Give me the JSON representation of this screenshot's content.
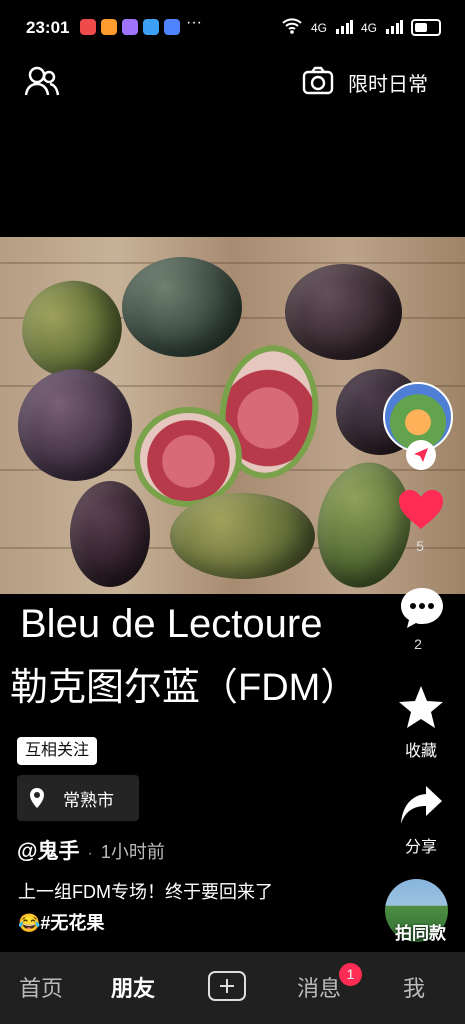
{
  "status_bar": {
    "time": "23:01",
    "dots": "···",
    "signal_4g": "4G",
    "signal_4g_2": "4G",
    "wifi_label": "6"
  },
  "top_nav": {
    "camera_label": "限时日常"
  },
  "video": {
    "title_en": "Bleu de Lectoure",
    "title_zh": "勒克图尔蓝（FDM）"
  },
  "tag": {
    "label": "互相关注"
  },
  "location": {
    "label": "常熟市"
  },
  "post": {
    "author": "@鬼手",
    "separator": "·",
    "time_ago": "1小时前",
    "caption_text": "上一组FDM专场！终于要回来了",
    "emoji": "😂",
    "hashtag": "#无花果"
  },
  "actions": {
    "like_count": "5",
    "comment_count": "2",
    "collect_label": "收藏",
    "share_label": "分享",
    "same_style_label": "拍同款"
  },
  "bottom_nav": {
    "home": "首页",
    "friends": "朋友",
    "messages": "消息",
    "messages_badge": "1",
    "me": "我"
  },
  "colors": {
    "accent": "#fe2c55",
    "background": "#000000",
    "bottom_bar": "#202020"
  }
}
